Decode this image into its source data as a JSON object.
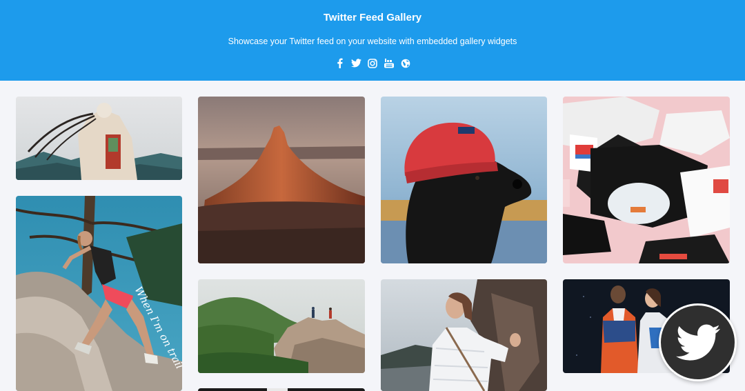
{
  "header": {
    "title": "Twitter Feed Gallery",
    "subtitle": "Showcase your Twitter feed on your website with embedded gallery widgets",
    "social_icons": [
      "facebook-icon",
      "twitter-icon",
      "instagram-icon",
      "youtube-icon",
      "globe-icon"
    ]
  },
  "gallery": {
    "posts": [
      {
        "image": "hiker-with-braids-looking-at-mountains"
      },
      {
        "image": "red-rock-butte-at-sunset"
      },
      {
        "image": "black-dog-in-red-beanie"
      },
      {
        "image": "flat-lay-apparel-on-pink"
      },
      {
        "image": "woman-climbing-boulders",
        "overlay_text": "When I'm on trail"
      },
      {
        "image": "hikers-on-rocky-ridge"
      },
      {
        "image": "woman-in-white-puffer-by-rock"
      },
      {
        "image": "two-models-in-jackets"
      }
    ]
  },
  "floating_button": {
    "icon": "twitter-bird-icon"
  },
  "colors": {
    "header_bg": "#1d9bec",
    "page_bg": "#f4f5f9",
    "fab_bg": "#2f2f2f"
  }
}
